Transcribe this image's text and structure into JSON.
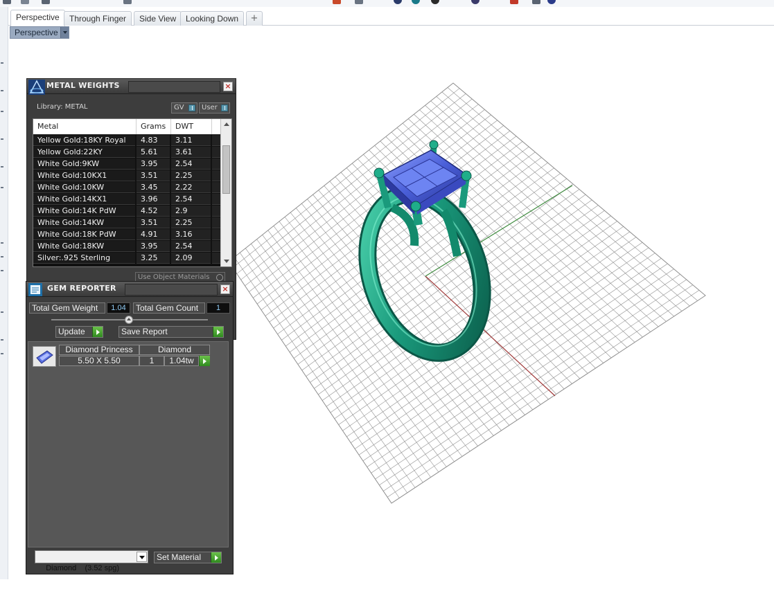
{
  "tabs": [
    {
      "label": "Perspective",
      "active": true
    },
    {
      "label": "Through Finger",
      "active": false
    },
    {
      "label": "Side View",
      "active": false
    },
    {
      "label": "Looking Down",
      "active": false
    }
  ],
  "tab_add_icon": "plus-icon",
  "viewport_label": "Perspective",
  "metal_weights": {
    "title": "METAL WEIGHTS",
    "library_label": "Library: METAL",
    "gv_label": "GV",
    "user_label": "User",
    "columns": [
      "Metal",
      "Grams",
      "DWT"
    ],
    "rows": [
      [
        "Yellow Gold:18KY Royal",
        "4.83",
        "3.11"
      ],
      [
        "Yellow Gold:22KY",
        "5.61",
        "3.61"
      ],
      [
        "White Gold:9KW",
        "3.95",
        "2.54"
      ],
      [
        "White Gold:10KX1",
        "3.51",
        "2.25"
      ],
      [
        "White Gold:10KW",
        "3.45",
        "2.22"
      ],
      [
        "White Gold:14KX1",
        "3.96",
        "2.54"
      ],
      [
        "White Gold:14K PdW",
        "4.52",
        "2.9"
      ],
      [
        "White Gold:14KW",
        "3.51",
        "2.25"
      ],
      [
        "White Gold:18K PdW",
        "4.91",
        "3.16"
      ],
      [
        "White Gold:18KW",
        "3.95",
        "2.54"
      ],
      [
        "Silver:.925 Sterling",
        "3.25",
        "2.09"
      ]
    ],
    "use_object_materials": "Use Object Materials"
  },
  "gem_reporter": {
    "title": "GEM REPORTER",
    "total_weight_label": "Total Gem Weight",
    "total_weight_value": "1.04",
    "total_count_label": "Total Gem Count",
    "total_count_value": "1",
    "update_label": "Update",
    "save_report_label": "Save Report",
    "gem": {
      "name": "Diamond Princess",
      "size": "5.50 X 5.50",
      "material": "Diamond",
      "count": "1",
      "weight": "1.04tw"
    },
    "material_select": "Diamond    (3.52 spg)",
    "set_material_label": "Set Material"
  },
  "colors": {
    "panel_bg": "#3d3d3d",
    "ring_metal": "#1a9a7c",
    "gem_blue": "#4a5fd8",
    "grid_line": "#8f8f8f",
    "x_axis": "#a03a3a",
    "y_axis": "#3d8a3d",
    "play_button": "#3f9a2a"
  }
}
